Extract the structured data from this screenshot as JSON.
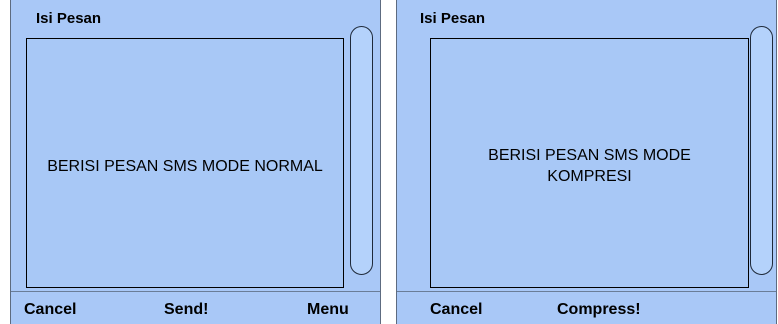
{
  "screens": [
    {
      "title": "Isi Pesan",
      "message": "BERISI PESAN SMS MODE NORMAL",
      "softkeys": {
        "left": "Cancel",
        "center": "Send!",
        "right": "Menu"
      }
    },
    {
      "title": "Isi Pesan",
      "message": "BERISI PESAN SMS MODE KOMPRESI",
      "softkeys": {
        "left": "Cancel",
        "center": "Compress!"
      }
    }
  ],
  "colors": {
    "screen_background": "#a9c8f7",
    "text": "#000000",
    "border": "#000000"
  }
}
